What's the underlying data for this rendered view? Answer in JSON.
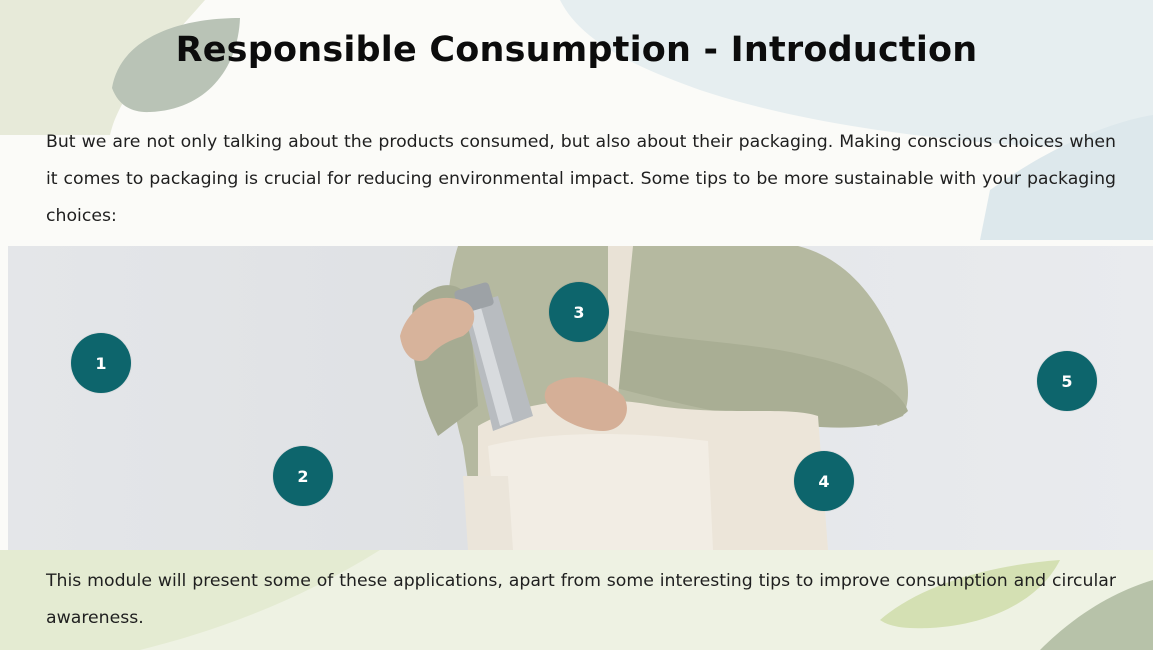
{
  "slide": {
    "title": "Responsible Consumption - Introduction",
    "intro_text": "But we are not only talking about the products consumed, but also about their packaging. Making conscious choices when it comes to packaging is crucial for reducing environmental impact. Some tips to be more sustainable with your packaging choices:",
    "hotspots": [
      {
        "label": "1"
      },
      {
        "label": "2"
      },
      {
        "label": "3"
      },
      {
        "label": "4"
      },
      {
        "label": "5"
      }
    ],
    "outro_text": "This module will present some of these applications, apart from some interesting tips to improve consumption and circular awareness."
  },
  "colors": {
    "hotspot": "#0d656c",
    "leaf_sage": "#b9c3b6",
    "leaf_pale": "#dfe8ec",
    "leaf_green": "#c9d99e"
  }
}
